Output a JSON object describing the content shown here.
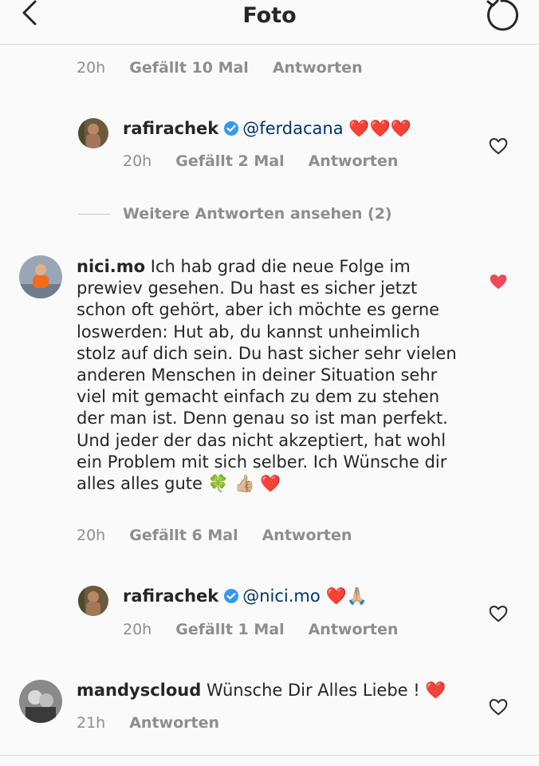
{
  "header": {
    "title": "Foto",
    "back_icon": "chevron-left-icon",
    "refresh_icon": "refresh-icon"
  },
  "top_meta": {
    "time": "20h",
    "likes": "Gefällt 10 Mal",
    "reply": "Antworten"
  },
  "reply1": {
    "username": "rafirachek",
    "mention": "@ferdacana",
    "emoji": "❤️❤️❤️",
    "time": "20h",
    "likes": "Gefällt 2 Mal",
    "reply": "Antworten",
    "liked": false
  },
  "more_replies": "Weitere Antworten ansehen (2)",
  "comment2": {
    "username": "nici.mo",
    "text": "Ich hab grad die neue Folge im prewiev gesehen. Du hast es sicher jetzt schon oft gehört, aber ich möchte es gerne loswerden: Hut ab, du kannst unheimlich stolz auf dich sein. Du hast sicher sehr vielen anderen Menschen in deiner Situation sehr viel mit gemacht einfach zu dem zu stehen der man ist. Denn genau so ist man perfekt. Und jeder der das nicht akzeptiert, hat wohl ein Problem mit sich selber. Ich Wünsche dir alles alles gute 🍀 👍🏼 ❤️",
    "time": "20h",
    "likes": "Gefällt 6 Mal",
    "reply": "Antworten",
    "liked": true
  },
  "reply2": {
    "username": "rafirachek",
    "mention": "@nici.mo",
    "emoji": "❤️🙏🏼",
    "time": "20h",
    "likes": "Gefällt 1 Mal",
    "reply": "Antworten",
    "liked": false
  },
  "comment3": {
    "username": "mandyscloud",
    "text": "Wünsche Dir Alles Liebe ! ❤️",
    "time": "21h",
    "reply": "Antworten",
    "liked": false
  },
  "colors": {
    "like_red": "#ed4956",
    "verified_blue": "#3897f0",
    "mention_blue": "#003569",
    "muted": "#8e8e8e"
  }
}
